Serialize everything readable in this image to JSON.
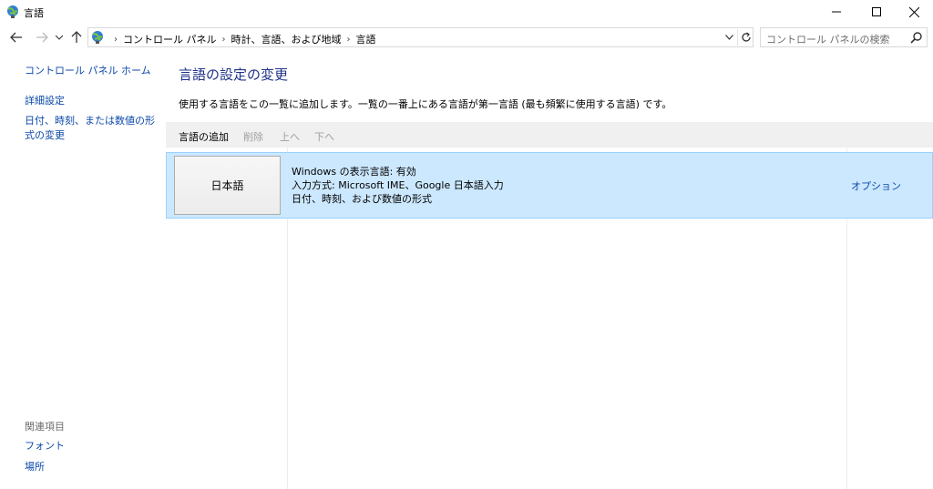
{
  "window": {
    "title": "言語"
  },
  "navigation": {
    "breadcrumbs": [
      "コントロール パネル",
      "時計、言語、および地域",
      "言語"
    ],
    "search_placeholder": "コントロール パネルの検索"
  },
  "sidebar": {
    "home": "コントロール パネル ホーム",
    "advanced": "詳細設定",
    "datetime": "日付、時刻、または数値の形式の変更",
    "related_header": "関連項目",
    "font": "フォント",
    "location": "場所"
  },
  "main": {
    "title": "言語の設定の変更",
    "description": "使用する言語をこの一覧に追加します。一覧の一番上にある言語が第一言語 (最も頻繁に使用する言語) です。",
    "toolbar": {
      "add": "言語の追加",
      "remove": "削除",
      "up": "上へ",
      "down": "下へ"
    },
    "languages": [
      {
        "name": "日本語",
        "display_language": "Windows の表示言語: 有効",
        "input_methods": "入力方式: Microsoft IME、Google 日本語入力",
        "format": "日付、時刻、および数値の形式",
        "options": "オプション"
      }
    ]
  },
  "colors": {
    "link": "#0c49a8",
    "title": "#1e3287",
    "selected_row": "#cce8ff",
    "selected_border": "#99d1ff",
    "toolbar_bg": "#f0f0f0"
  }
}
